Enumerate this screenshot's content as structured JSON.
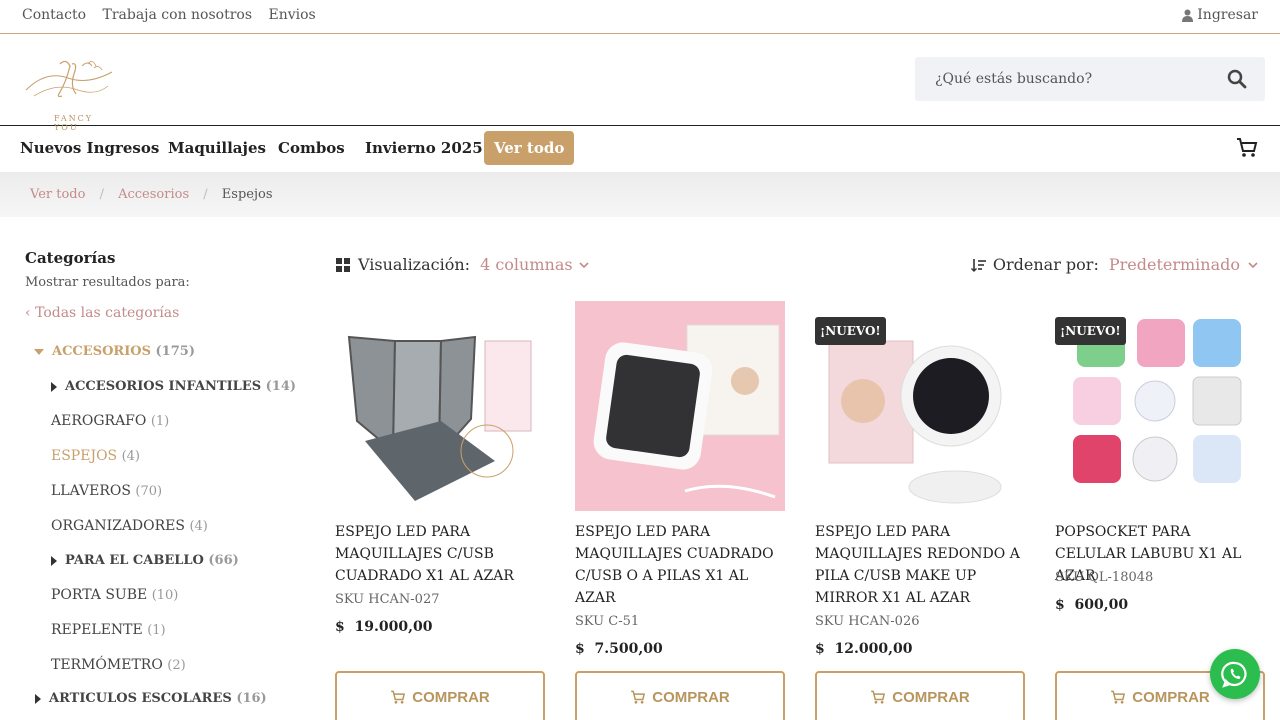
{
  "topbar": {
    "links": [
      "Contacto",
      "Trabaja con nosotros",
      "Envios"
    ],
    "login": "Ingresar"
  },
  "brand": {
    "logo_text": "FANCY YOU"
  },
  "search": {
    "placeholder": "¿Qué estás buscando?"
  },
  "nav": {
    "items": [
      "Nuevos Ingresos",
      "Maquillajes",
      "Combos",
      "Invierno 2025"
    ],
    "cta": "Ver todo"
  },
  "breadcrumb": {
    "items": [
      "Ver todo",
      "Accesorios"
    ],
    "current": "Espejos"
  },
  "sidebar": {
    "title": "Categorías",
    "subtitle": "Mostrar resultados para:",
    "all": "Todas las categorías",
    "categories": [
      {
        "label": "ACCESORIOS",
        "count": "(175)"
      },
      {
        "label": "ACCESORIOS INFANTILES",
        "count": "(14)"
      },
      {
        "label": "AEROGRAFO",
        "count": "(1)"
      },
      {
        "label": "ESPEJOS",
        "count": "(4)"
      },
      {
        "label": "LLAVEROS",
        "count": "(70)"
      },
      {
        "label": "ORGANIZADORES",
        "count": "(4)"
      },
      {
        "label": "PARA EL CABELLO",
        "count": "(66)"
      },
      {
        "label": "PORTA SUBE",
        "count": "(10)"
      },
      {
        "label": "REPELENTE",
        "count": "(1)"
      },
      {
        "label": "TERMÓMETRO",
        "count": "(2)"
      },
      {
        "label": "ARTICULOS ESCOLARES",
        "count": "(16)"
      }
    ]
  },
  "controls": {
    "viz_label": "Visualización:",
    "viz_value": "4 columnas",
    "sort_label": "Ordenar por:",
    "sort_value": "Predeterminado"
  },
  "products": [
    {
      "name": "ESPEJO LED PARA MAQUILLAJES C/USB CUADRADO X1 AL AZAR",
      "sku": "SKU HCAN-027",
      "currency": "$",
      "price": "19.000,00",
      "badge": "",
      "buy": "COMPRAR"
    },
    {
      "name": "ESPEJO LED PARA MAQUILLAJES CUADRADO C/USB O A PILAS X1 AL AZAR",
      "sku": "SKU C-51",
      "currency": "$",
      "price": "7.500,00",
      "badge": "",
      "buy": "COMPRAR"
    },
    {
      "name": "ESPEJO LED PARA MAQUILLAJES REDONDO A PILA C/USB MAKE UP MIRROR X1 AL AZAR",
      "sku": "SKU HCAN-026",
      "currency": "$",
      "price": "12.000,00",
      "badge": "¡NUEVO!",
      "buy": "COMPRAR"
    },
    {
      "name": "POPSOCKET PARA CELULAR LABUBU X1 AL AZAR",
      "sku": "SKU QL-18048",
      "currency": "$",
      "price": "600,00",
      "badge": "¡NUEVO!",
      "buy": "COMPRAR"
    }
  ],
  "colors": {
    "accent": "#c9a06a",
    "link": "#c58a8a",
    "whatsapp": "#2bbd4e"
  }
}
